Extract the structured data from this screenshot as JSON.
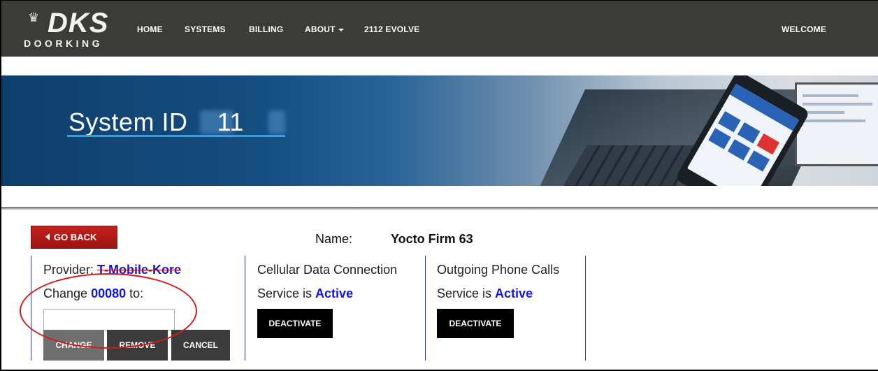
{
  "navbar": {
    "logo": {
      "wordmark": "DKS",
      "brand": "DOORKING"
    },
    "items": [
      "HOME",
      "SYSTEMS",
      "BILLING",
      "ABOUT",
      "2112 EVOLVE"
    ],
    "welcome": "WELCOME"
  },
  "hero": {
    "title": "System ID    11"
  },
  "actions": {
    "go_back": "GO BACK"
  },
  "system": {
    "name_label": "Name:",
    "name_value": "Yocto Firm 63"
  },
  "provider": {
    "label": "Provider:",
    "value": "T-Mobile-Kore",
    "change_prefix": "Change",
    "change_number": "00080",
    "change_suffix": "to:",
    "input_value": "",
    "buttons": {
      "change": "CHANGE",
      "remove": "REMOVE",
      "cancel": "CANCEL"
    }
  },
  "cellular": {
    "title": "Cellular Data Connection",
    "service_prefix": "Service is",
    "status": "Active",
    "button": "DEACTIVATE"
  },
  "phone_calls": {
    "title": "Outgoing Phone Calls",
    "service_prefix": "Service is",
    "status": "Active",
    "button": "DEACTIVATE"
  },
  "colors": {
    "navbar_bg": "#3b3b38",
    "accent_blue": "#1414e6",
    "go_back_red": "#b01a16",
    "annotation_red": "#d31a1a"
  }
}
